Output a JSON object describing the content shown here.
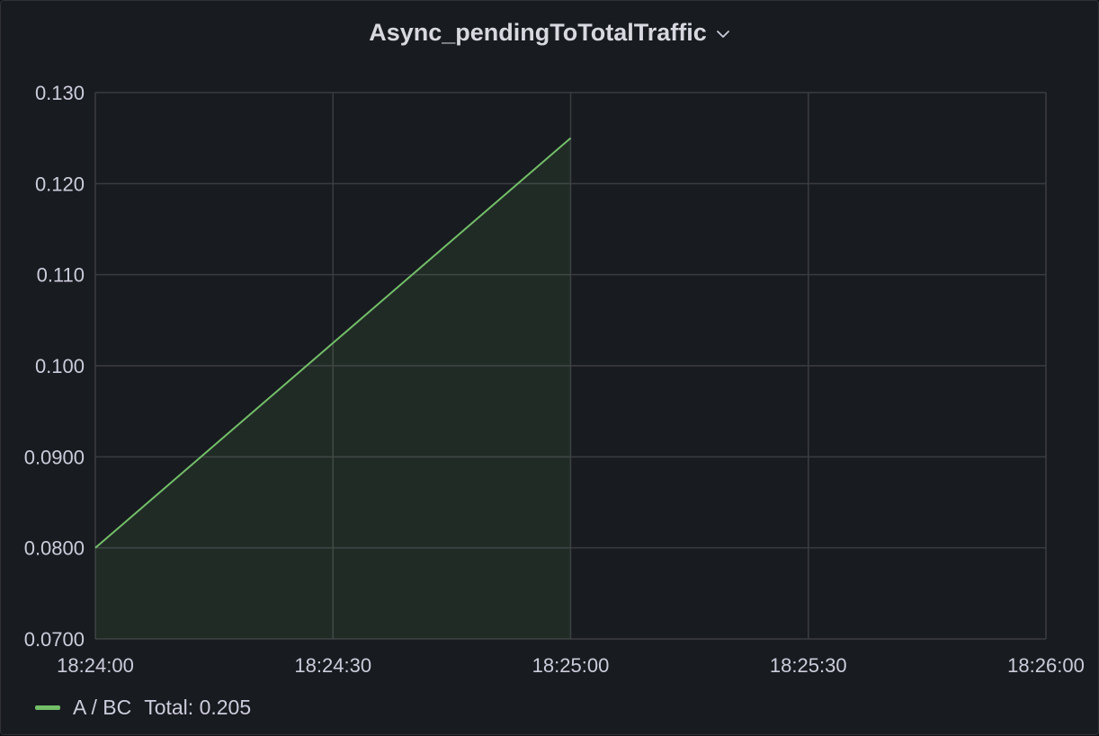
{
  "panel": {
    "title": "Async_pendingToTotalTraffic"
  },
  "icons": {
    "title_menu": "chevron-down-icon"
  },
  "colors": {
    "series": "#73bf69",
    "grid": "#3a3c42",
    "background": "#181b1f",
    "text": "#ccccdc"
  },
  "chart_data": {
    "type": "area",
    "title": "Async_pendingToTotalTraffic",
    "xlabel": "",
    "ylabel": "",
    "x_ticks": [
      "18:24:00",
      "18:24:30",
      "18:25:00",
      "18:25:30",
      "18:26:00"
    ],
    "y_ticks": [
      "0.0700",
      "0.0800",
      "0.0900",
      "0.100",
      "0.110",
      "0.120",
      "0.130"
    ],
    "xlim": [
      "18:24:00",
      "18:26:00"
    ],
    "ylim": [
      0.07,
      0.13
    ],
    "grid": true,
    "legend_position": "bottom-left",
    "series": [
      {
        "name": "A / BC",
        "x": [
          "18:24:00",
          "18:25:00"
        ],
        "y": [
          0.08,
          0.125
        ],
        "fill": true
      }
    ]
  },
  "legend": {
    "items": [
      {
        "label": "A / BC",
        "stat_label": "Total: 0.205"
      }
    ]
  }
}
